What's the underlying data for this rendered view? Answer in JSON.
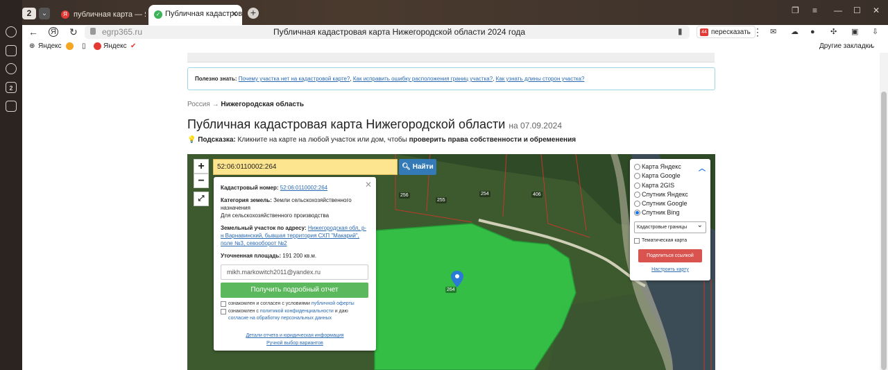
{
  "browser": {
    "tab_count": "2",
    "tabs": [
      {
        "label": "публичная карта — Яндекс"
      },
      {
        "label": "Публичная кадастров"
      }
    ],
    "url": "egrp365.ru",
    "page_title": "Публичная кадастровая карта Нижегородской области 2024 года",
    "retell_label": "пересказать",
    "bookmarks": [
      {
        "label": "Яндекс"
      },
      {
        "label": "Яндекс"
      }
    ],
    "other_bookmarks": "Другие закладки"
  },
  "info": {
    "prefix": "Полезно знать:",
    "links": [
      "Почему участка нет на кадастровой карте?",
      "Как исправить ошибку расположения границ участка?",
      "Как узнать длины сторон участка?"
    ]
  },
  "breadcrumb": {
    "root": "Россия",
    "arrow": "→",
    "current": "Нижегородская область"
  },
  "heading": {
    "title": "Публичная кадастровая карта Нижегородской области",
    "date": "на 07.09.2024"
  },
  "hint": {
    "label": "Подсказка:",
    "text": "Кликните на карте на любой участок или дом, чтобы",
    "bold": "проверить права собственности и обременения"
  },
  "map": {
    "search_value": "52:06:0110002:264",
    "find_label": "Найти",
    "zoom_in": "+",
    "zoom_out": "−",
    "plot_labels": [
      "256",
      "255",
      "254",
      "406",
      "264"
    ],
    "popup": {
      "cad_label": "Кадастровый номер:",
      "cad_value": "52:06:0110002:264",
      "category_label": "Категория земель:",
      "category_value": "Земли сельскохозяйственного назначения",
      "category_use": "Для сельскохозяйственного производства",
      "address_label": "Земельный участок по адресу:",
      "address_value": "Нижегородская обл, р-н Варнавинский, бывшая территория СХП \"Макарий\", поле №3, севооборот №2",
      "area_label": "Уточненная площадь:",
      "area_value": "191 200 кв.м.",
      "email": "mikh.markowitch2011@yandex.ru",
      "get_report": "Получить подробный отчет",
      "agree1": "ознакомлен и согласен с условиями",
      "agree1_link": "публичной оферты",
      "agree2": "ознакомлен с",
      "agree2_link": "политикой конфиденциальности",
      "agree2_mid": "и даю",
      "agree2_link2": "согласие на обработку персональных данных",
      "details_link": "Детали отчета и юридическая информация",
      "manual_link": "Ручной выбор вариантов"
    },
    "layers": {
      "options": [
        {
          "label": "Карта Яндекс",
          "selected": false
        },
        {
          "label": "Карта Google",
          "selected": false
        },
        {
          "label": "Карта 2GIS",
          "selected": false
        },
        {
          "label": "Спутник Яндекс",
          "selected": false
        },
        {
          "label": "Спутник Google",
          "selected": false
        },
        {
          "label": "Спутник Bing",
          "selected": true
        }
      ],
      "select_value": "Кадастровые границы",
      "thematic": "Тематическая карта",
      "share": "Поделиться ссылкой",
      "configure": "Настроить карту"
    }
  }
}
